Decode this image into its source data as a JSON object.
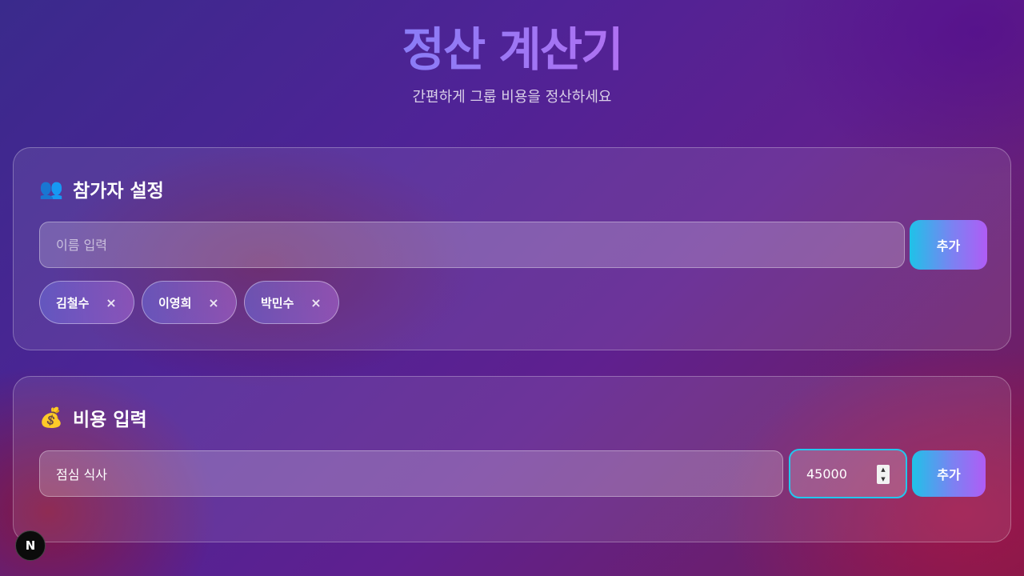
{
  "header": {
    "title": "정산 계산기",
    "subtitle": "간편하게 그룹 비용을 정산하세요"
  },
  "participants": {
    "emoji": "👥",
    "title": "참가자 설정",
    "name_placeholder": "이름 입력",
    "add_label": "추가",
    "people": [
      {
        "name": "김철수",
        "remove": "×"
      },
      {
        "name": "이영희",
        "remove": "×"
      },
      {
        "name": "박민수",
        "remove": "×"
      }
    ]
  },
  "expenses": {
    "emoji": "💰",
    "title": "비용 입력",
    "description_value": "점심 식사",
    "amount_value": "45000",
    "add_label": "추가"
  },
  "dev_badge": {
    "letter": "N",
    "icon": "nextjs-logo-icon"
  },
  "colors": {
    "accent_cyan": "#22d3ee",
    "accent_purple": "#b05cf5",
    "title_pink": "#ff5fa8"
  }
}
